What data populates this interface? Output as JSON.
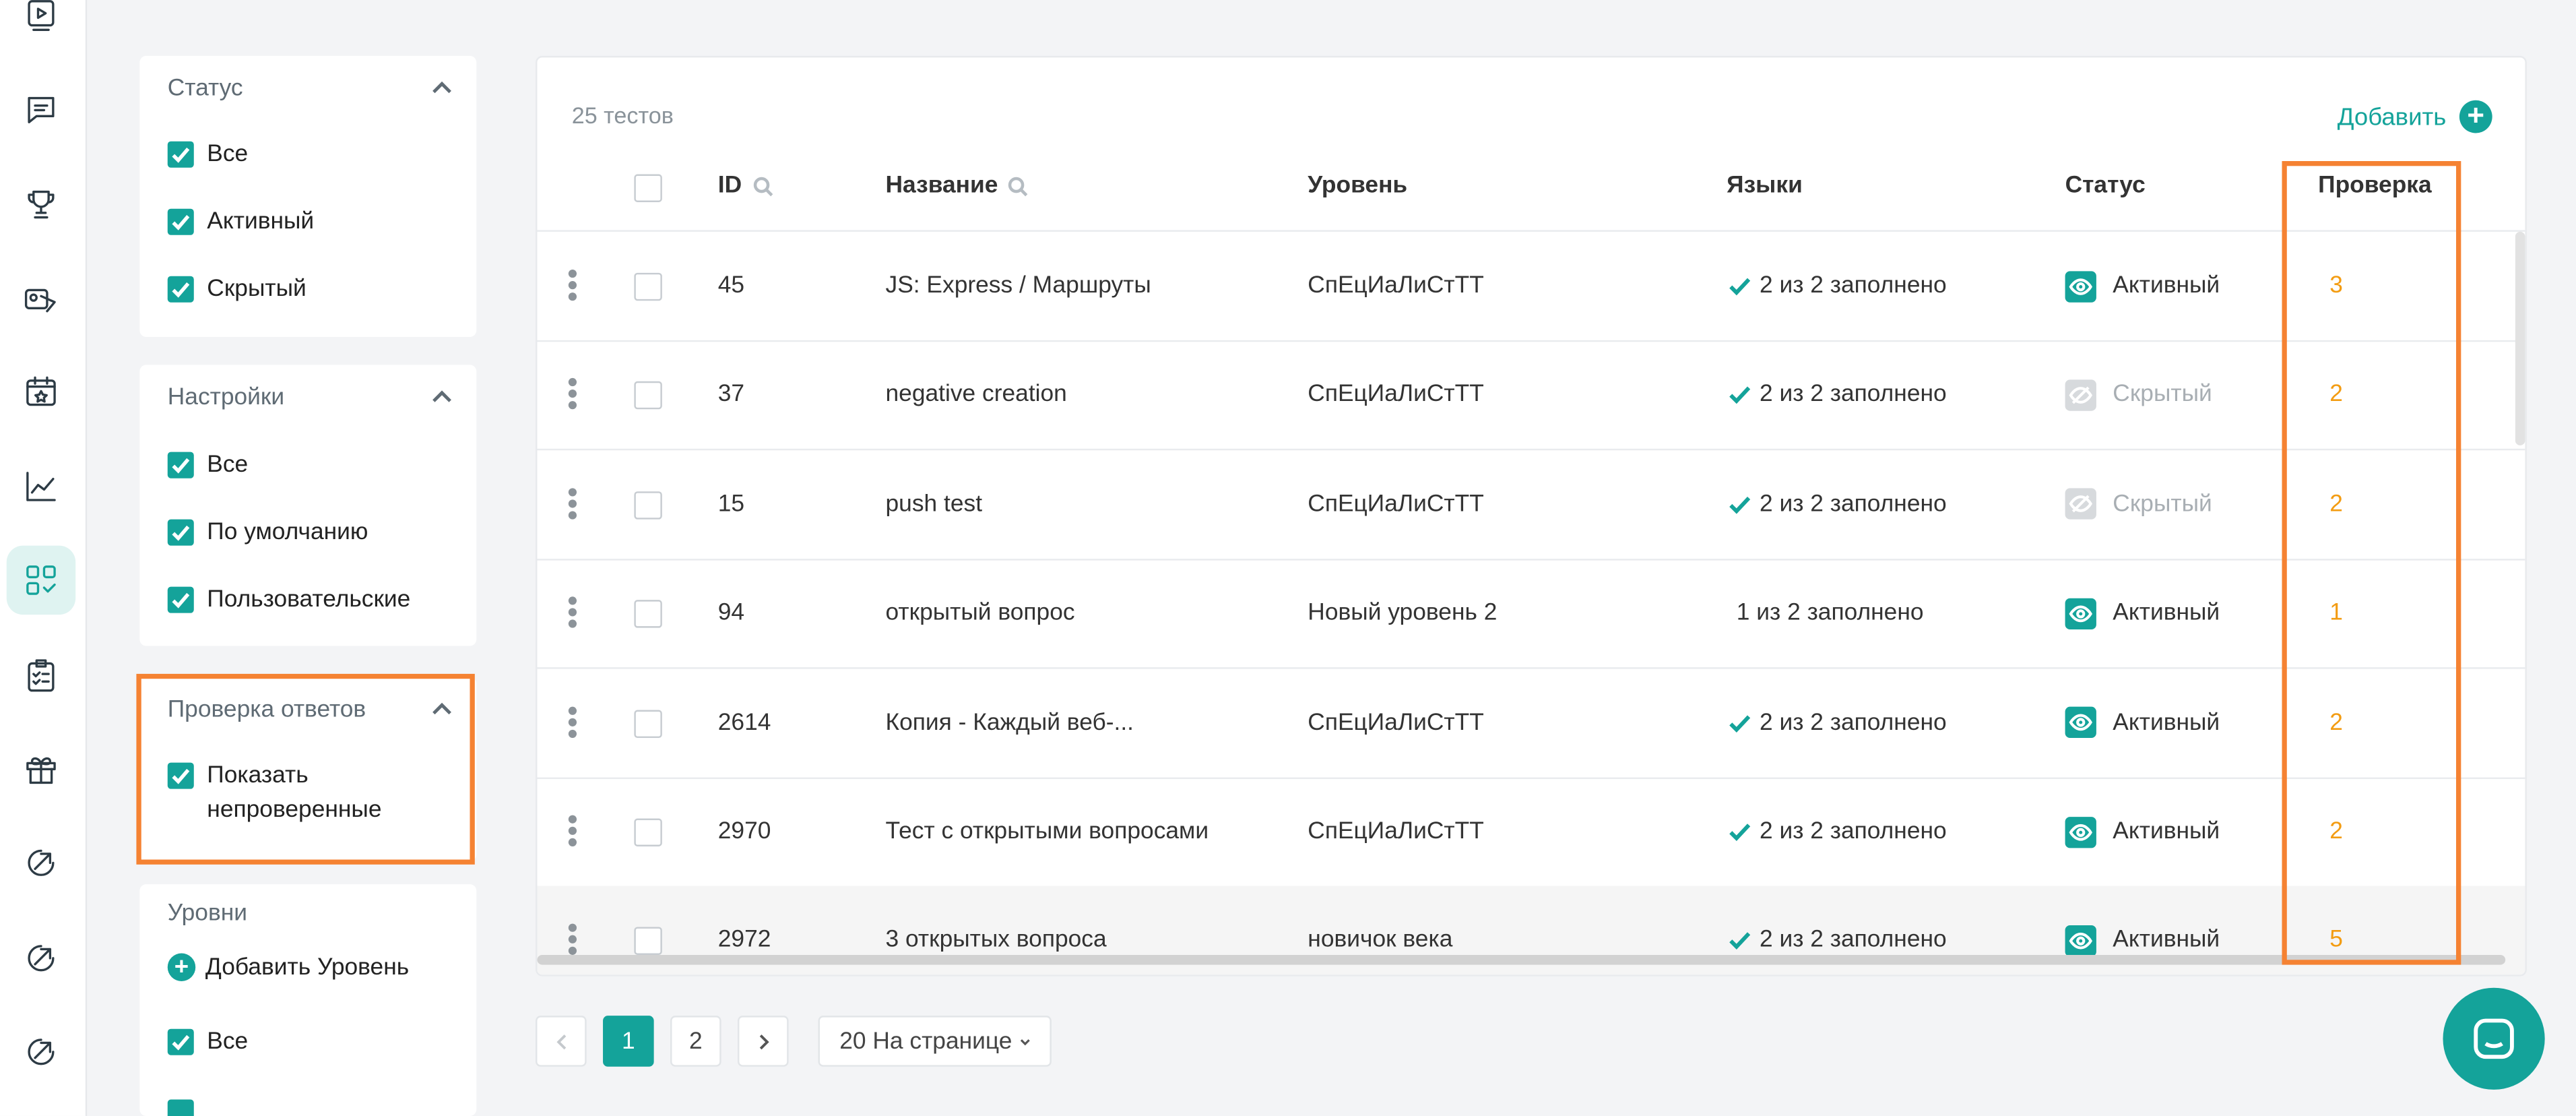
{
  "colors": {
    "accent": "#14a39a",
    "highlight": "#f58232",
    "check_count": "#f39c12"
  },
  "rail": {
    "icons": [
      "video-icon",
      "chat-icon",
      "trophy-icon",
      "id-card-icon",
      "calendar-star-icon",
      "chart-icon",
      "tests-grid-icon",
      "checklist-icon",
      "gift-icon",
      "arrow-circle-icon",
      "arrow-circle-icon",
      "arrow-circle-icon"
    ],
    "active": "tests-grid-icon"
  },
  "filters": {
    "status": {
      "title": "Статус",
      "items": [
        "Все",
        "Активный",
        "Скрытый"
      ]
    },
    "settings": {
      "title": "Настройки",
      "items": [
        "Все",
        "По умолчанию",
        "Пользовательские"
      ]
    },
    "answer_check": {
      "title": "Проверка ответов",
      "item_line1": "Показать",
      "item_line2": "непроверенные"
    },
    "levels": {
      "title": "Уровни",
      "add_label": "Добавить Уровень",
      "items": [
        "Все"
      ]
    }
  },
  "table": {
    "count": "25 тестов",
    "add_label": "Добавить",
    "columns": {
      "id": "ID",
      "name": "Название",
      "level": "Уровень",
      "langs": "Языки",
      "status": "Статус",
      "check": "Проверка"
    },
    "rows": [
      {
        "id": "45",
        "name": "JS: Express / Маршруты",
        "level": "СпЕцИаЛиСтТТ",
        "langs": "2 из 2 заполнено",
        "langs_check": true,
        "status": "Активный",
        "active": true,
        "check": "3"
      },
      {
        "id": "37",
        "name": "negative creation",
        "level": "СпЕцИаЛиСтТТ",
        "langs": "2 из 2 заполнено",
        "langs_check": true,
        "status": "Скрытый",
        "active": false,
        "check": "2"
      },
      {
        "id": "15",
        "name": "push test",
        "level": "СпЕцИаЛиСтТТ",
        "langs": "2 из 2 заполнено",
        "langs_check": true,
        "status": "Скрытый",
        "active": false,
        "check": "2"
      },
      {
        "id": "94",
        "name": "открытый вопрос",
        "level": "Новый уровень 2",
        "langs": "1 из 2 заполнено",
        "langs_check": false,
        "status": "Активный",
        "active": true,
        "check": "1"
      },
      {
        "id": "2614",
        "name": "Копия - Каждый веб-...",
        "level": "СпЕцИаЛиСтТТ",
        "langs": "2 из 2 заполнено",
        "langs_check": true,
        "status": "Активный",
        "active": true,
        "check": "2"
      },
      {
        "id": "2970",
        "name": "Тест с открытыми вопросами",
        "level": "СпЕцИаЛиСтТТ",
        "langs": "2 из 2 заполнено",
        "langs_check": true,
        "status": "Активный",
        "active": true,
        "check": "2"
      },
      {
        "id": "2972",
        "name": "3 открытых вопроса",
        "level": "новичок века",
        "langs": "2 из 2 заполнено",
        "langs_check": true,
        "status": "Активный",
        "active": true,
        "check": "5"
      }
    ]
  },
  "pagination": {
    "pages": [
      "1",
      "2"
    ],
    "current": "1",
    "per_page": "20 На странице"
  }
}
